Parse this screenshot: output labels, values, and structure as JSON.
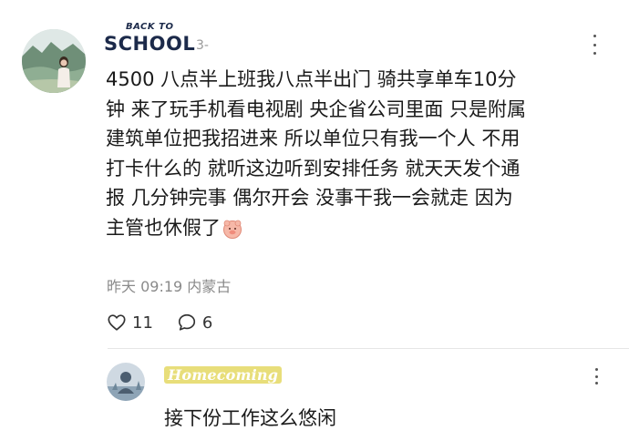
{
  "comment1": {
    "username_badge_small": "BACK TO",
    "username_badge_big": "SCHOOL",
    "username_suffix": "3-",
    "text": "4500 八点半上班我八点半出门 骑共享单车10分\n钟 来了玩手机看电视剧 央企省公司里面 只是附属\n建筑单位把我招进来 所以单位只有我一个人 不用\n打卡什么的 就听这边听到安排任务 就天天发个通\n报 几分钟完事 偶尔开会 没事干我一会就走 因为\n主管也休假了",
    "emoji": "smiling-face-emoji",
    "meta": "昨天 09:19 内蒙古",
    "likes": "11",
    "replies": "6"
  },
  "comment2": {
    "username": "Homecoming",
    "text": "接下份工作这么悠闲"
  },
  "colors": {
    "badge_text": "#1c2a4a",
    "meta_text": "#8a8a8a",
    "name_highlight": "#e8de7a"
  }
}
